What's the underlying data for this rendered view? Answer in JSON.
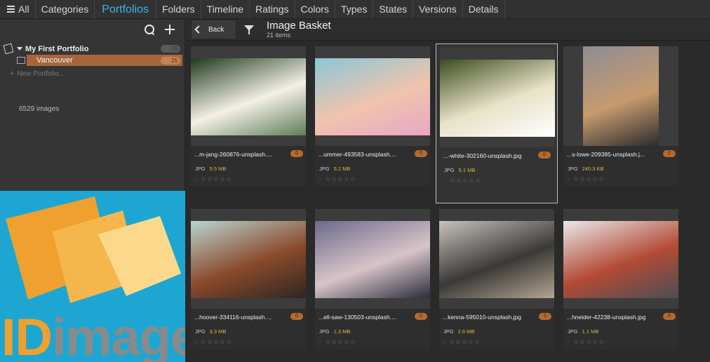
{
  "nav": {
    "items": [
      "All",
      "Categories",
      "Portfolios",
      "Folders",
      "Timeline",
      "Ratings",
      "Colors",
      "Types",
      "States",
      "Versions",
      "Details"
    ],
    "active_index": 2
  },
  "sidebar": {
    "root_label": "My First Portfolio",
    "root_count": "25",
    "child_label": "Vancouver",
    "child_count": "25",
    "new_portfolio": "New Portfolio...",
    "image_count": "6529 images"
  },
  "logo": {
    "id_part": "ID",
    "rest_part": "imager",
    "colors": {
      "background": "#1ea6d3",
      "accent": "#f0a02e",
      "text_gray": "#8a8a8a"
    }
  },
  "toolbar": {
    "back_label": "Back",
    "title": "Image Basket",
    "subtitle": "21 items"
  },
  "cards": [
    {
      "name": "...m-jang-260876-unsplash....",
      "badge": "0",
      "type": "JPG",
      "size": "5.5 MB",
      "colors": [
        "#1f3a1d",
        "#f4f0e6",
        "#5e7d58"
      ]
    },
    {
      "name": "...ummer-493583-unsplash....",
      "badge": "0",
      "type": "JPG",
      "size": "5.2 MB",
      "colors": [
        "#8ac7d8",
        "#f0c4ad",
        "#e9a6c5"
      ]
    },
    {
      "name": "...-white-302160-unsplash.jpg",
      "badge": "0",
      "type": "JPG",
      "size": "5.1 MB",
      "colors": [
        "#3c4d1f",
        "#e8e2c8",
        "#ffffff"
      ]
    },
    {
      "name": "...s-lowe-209385-unsplash.j...",
      "badge": "0",
      "type": "JPG",
      "size": "240.3 KB",
      "colors": [
        "#8f8c93",
        "#c69b6e",
        "#2b2b2e"
      ]
    },
    {
      "name": "...hoover-334116-unsplash....",
      "badge": "0",
      "type": "JPG",
      "size": "3.3 MB",
      "colors": [
        "#b9d4d1",
        "#8a4a2b",
        "#2e2622"
      ]
    },
    {
      "name": "...ell-saw-130503-unsplash....",
      "badge": "0",
      "type": "JPG",
      "size": "1.3 MB",
      "colors": [
        "#6b6a8a",
        "#d8c4c8",
        "#2a2d3c"
      ]
    },
    {
      "name": "...kenna-595010-unsplash.jpg",
      "badge": "0",
      "type": "JPG",
      "size": "2.6 MB",
      "colors": [
        "#c7c2bd",
        "#3b3937",
        "#b2a592"
      ]
    },
    {
      "name": "...hneider-42238-unsplash.jpg",
      "badge": "0",
      "type": "JPG",
      "size": "1.1 MB",
      "colors": [
        "#e9e9ea",
        "#b34a35",
        "#4a4f55"
      ]
    }
  ],
  "selected_card": 2
}
